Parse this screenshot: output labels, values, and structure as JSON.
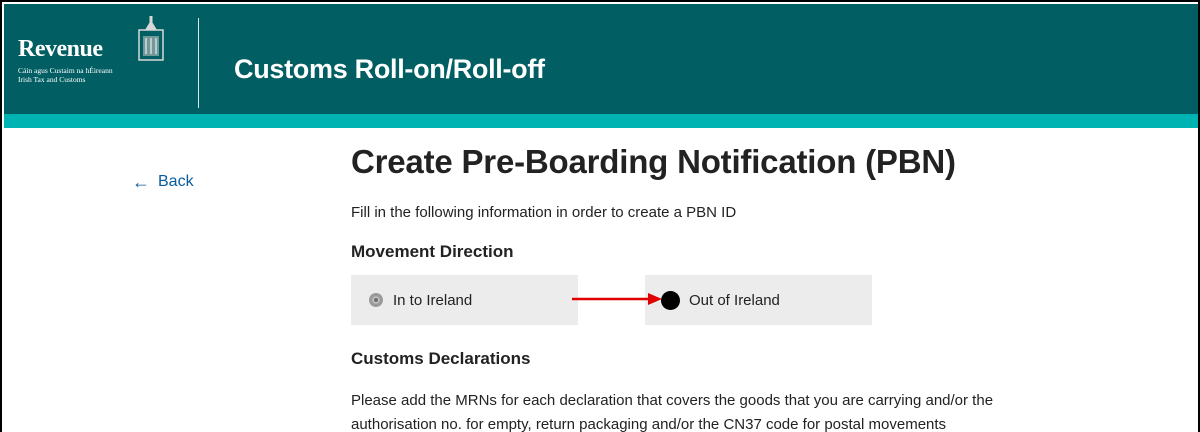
{
  "header": {
    "logo_word": "Revenue",
    "logo_sub_line1": "Cáin agus Custaim na hÉireann",
    "logo_sub_line2": "Irish Tax and Customs",
    "app_title": "Customs Roll-on/Roll-off"
  },
  "nav": {
    "back_label": "Back",
    "back_icon": "arrow-left-icon"
  },
  "main": {
    "page_title": "Create Pre-Boarding Notification (PBN)",
    "intro": "Fill in the following information in order to create a PBN ID",
    "movement_direction": {
      "heading": "Movement Direction",
      "options": [
        {
          "label": "In to Ireland",
          "selected": false
        },
        {
          "label": "Out of Ireland",
          "selected": true
        }
      ]
    },
    "customs_declarations": {
      "heading": "Customs Declarations",
      "description_line1": "Please add the MRNs for each declaration that covers the goods that you are carrying and/or the",
      "description_line2": "authorisation no. for empty, return packaging and/or the CN37 code for postal movements"
    }
  },
  "colors": {
    "header_bg": "#015e62",
    "accent_strip": "#00b3b3",
    "link": "#0b5c9c",
    "annotation_arrow": "#e00000"
  }
}
